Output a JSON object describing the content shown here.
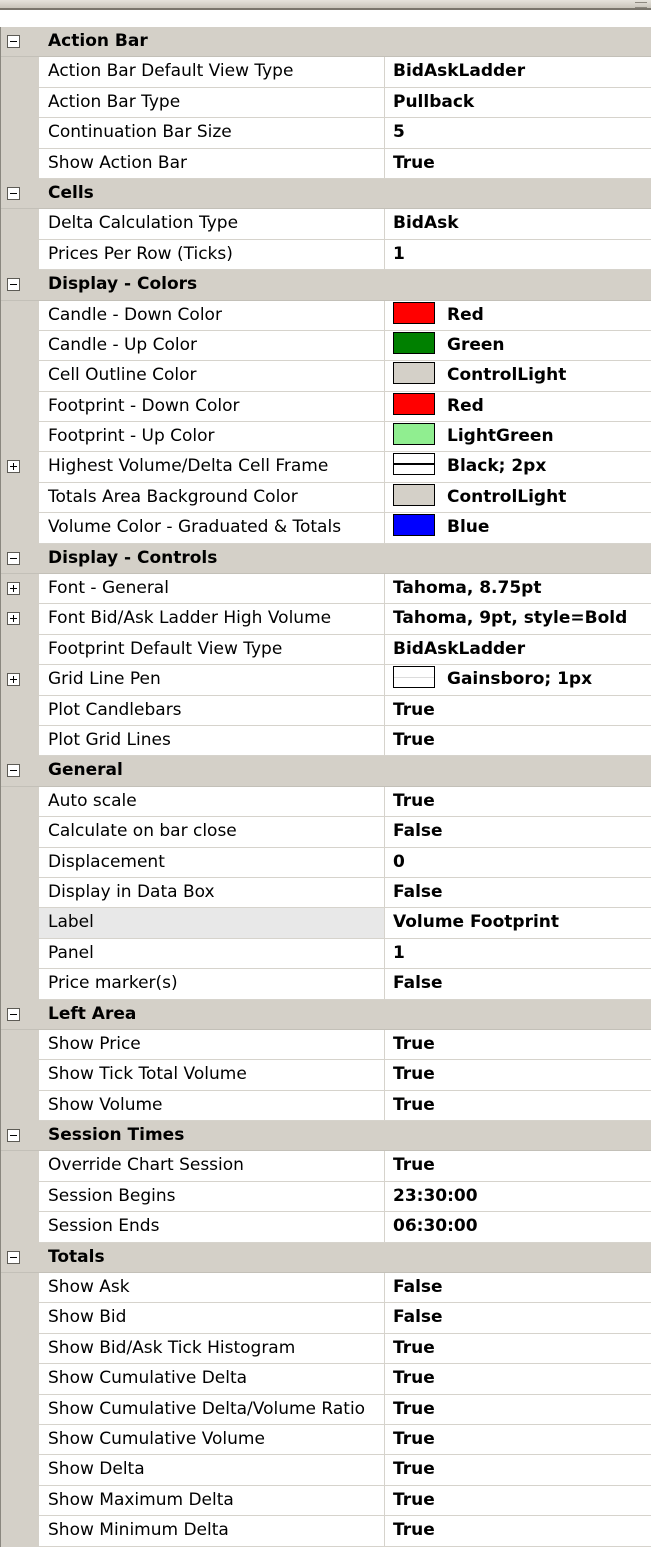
{
  "categories": [
    {
      "label": "Action Bar",
      "expanded": true,
      "properties": [
        {
          "name": "Action Bar Default View Type",
          "value": "BidAskLadder"
        },
        {
          "name": "Action Bar Type",
          "value": "Pullback"
        },
        {
          "name": "Continuation Bar Size",
          "value": "5"
        },
        {
          "name": "Show Action Bar",
          "value": "True"
        }
      ]
    },
    {
      "label": "Cells",
      "expanded": true,
      "properties": [
        {
          "name": "Delta Calculation Type",
          "value": "BidAsk"
        },
        {
          "name": "Prices Per Row (Ticks)",
          "value": "1"
        }
      ]
    },
    {
      "label": "Display - Colors",
      "expanded": true,
      "properties": [
        {
          "name": "Candle - Down Color",
          "value": "Red",
          "swatch": "#ff0000"
        },
        {
          "name": "Candle - Up Color",
          "value": "Green",
          "swatch": "#008000"
        },
        {
          "name": "Cell Outline Color",
          "value": "ControlLight",
          "swatch": "#d4d0c8"
        },
        {
          "name": "Footprint - Down Color",
          "value": "Red",
          "swatch": "#ff0000"
        },
        {
          "name": "Footprint - Up Color",
          "value": "LightGreen",
          "swatch": "#90ee90"
        },
        {
          "name": "Highest Volume/Delta Cell Frame",
          "value": "Black; 2px",
          "swatch": "#ffffff",
          "pen": "thick",
          "expandable": true
        },
        {
          "name": "Totals Area Background Color",
          "value": "ControlLight",
          "swatch": "#d4d0c8"
        },
        {
          "name": "Volume Color - Graduated & Totals",
          "value": "Blue",
          "swatch": "#0000ff"
        }
      ]
    },
    {
      "label": "Display - Controls",
      "expanded": true,
      "properties": [
        {
          "name": "Font - General",
          "value": "Tahoma, 8.75pt",
          "expandable": true
        },
        {
          "name": "Font Bid/Ask Ladder High Volume",
          "value": "Tahoma, 9pt, style=Bold",
          "expandable": true
        },
        {
          "name": "Footprint Default View Type",
          "value": "BidAskLadder"
        },
        {
          "name": "Grid Line Pen",
          "value": "Gainsboro; 1px",
          "swatch": "#ffffff",
          "pen": "thin",
          "expandable": true
        },
        {
          "name": "Plot Candlebars",
          "value": "True"
        },
        {
          "name": "Plot Grid Lines",
          "value": "True"
        }
      ]
    },
    {
      "label": "General",
      "expanded": true,
      "properties": [
        {
          "name": "Auto scale",
          "value": "True"
        },
        {
          "name": "Calculate on bar close",
          "value": "False"
        },
        {
          "name": "Displacement",
          "value": "0"
        },
        {
          "name": "Display in Data Box",
          "value": "False"
        },
        {
          "name": "Label",
          "value": "Volume Footprint",
          "selected": true
        },
        {
          "name": "Panel",
          "value": "1"
        },
        {
          "name": "Price marker(s)",
          "value": "False"
        }
      ]
    },
    {
      "label": "Left Area",
      "expanded": true,
      "properties": [
        {
          "name": "Show Price",
          "value": "True"
        },
        {
          "name": "Show Tick Total Volume",
          "value": "True"
        },
        {
          "name": "Show Volume",
          "value": "True"
        }
      ]
    },
    {
      "label": "Session Times",
      "expanded": true,
      "properties": [
        {
          "name": "Override Chart Session",
          "value": "True"
        },
        {
          "name": "Session Begins",
          "value": "23:30:00"
        },
        {
          "name": "Session Ends",
          "value": "06:30:00"
        }
      ]
    },
    {
      "label": "Totals",
      "expanded": true,
      "properties": [
        {
          "name": "Show Ask",
          "value": "False"
        },
        {
          "name": "Show Bid",
          "value": "False"
        },
        {
          "name": "Show Bid/Ask Tick Histogram",
          "value": "True"
        },
        {
          "name": "Show Cumulative Delta",
          "value": "True"
        },
        {
          "name": "Show Cumulative Delta/Volume Ratio",
          "value": "True"
        },
        {
          "name": "Show Cumulative Volume",
          "value": "True"
        },
        {
          "name": "Show Delta",
          "value": "True"
        },
        {
          "name": "Show Maximum Delta",
          "value": "True"
        },
        {
          "name": "Show Minimum Delta",
          "value": "True"
        }
      ]
    }
  ]
}
